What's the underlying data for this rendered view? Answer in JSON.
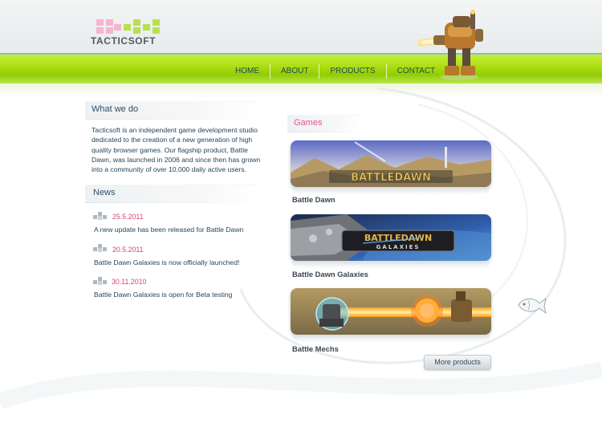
{
  "brand": {
    "name": "TACTICSOFT"
  },
  "nav": {
    "items": [
      "HOME",
      "ABOUT",
      "PRODUCTS",
      "CONTACT"
    ]
  },
  "about": {
    "title": "What we do",
    "text": "Tacticsoft is an independent game development studio dedicated to the creation of a new generation of high quality browser games. Our flagship product, Battle Dawn, was launched in 2006 and since then has grown into a community of over 10,000 daily active users."
  },
  "news": {
    "title": "News",
    "items": [
      {
        "date": "25.5.2011",
        "text": "A new update has been released for Battle Dawn"
      },
      {
        "date": "20.5.2011",
        "text": "Battle Dawn Galaxies is now officially launched!"
      },
      {
        "date": "30.11.2010",
        "text": "Battle Dawn Galaxies is open for Beta testing"
      }
    ]
  },
  "games": {
    "title": "Games",
    "items": [
      {
        "label": "Battle Dawn",
        "banner_text": "BATTLEDAWN"
      },
      {
        "label": "Battle Dawn Galaxies",
        "banner_text": "BATTLEDAWN",
        "banner_subtext": "GALAXIES"
      },
      {
        "label": "Battle Mechs"
      }
    ],
    "more_label": "More products"
  },
  "colors": {
    "accent_green": "#a8dc10",
    "date_pink": "#e0407a",
    "games_title": "#e5578b",
    "text": "#24465c"
  }
}
